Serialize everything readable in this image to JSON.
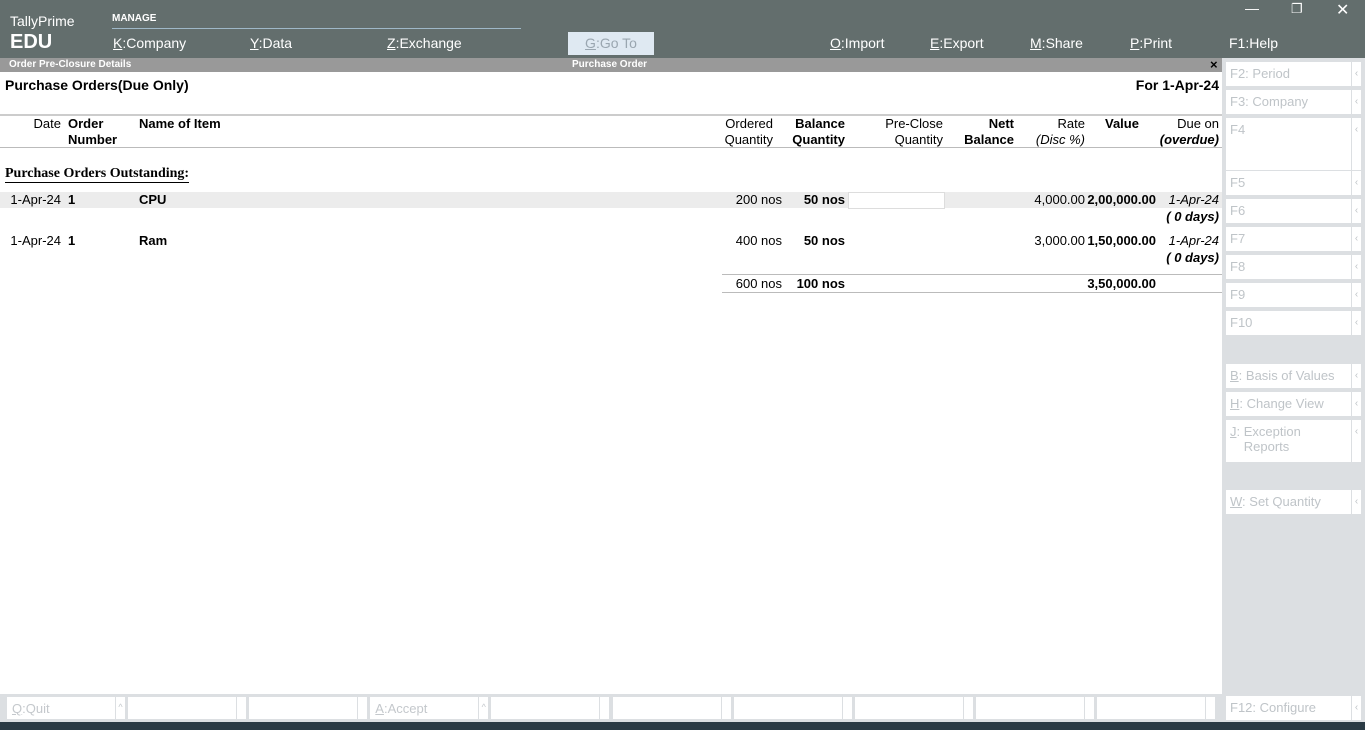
{
  "app": {
    "name": "TallyPrime",
    "edition": "EDU",
    "window_controls": [
      "minimize",
      "restore",
      "close"
    ]
  },
  "topmenu": {
    "section": "MANAGE",
    "items": [
      {
        "key": "K",
        "label": "Company"
      },
      {
        "key": "Y",
        "label": "Data"
      },
      {
        "key": "Z",
        "label": "Exchange"
      }
    ],
    "goto": {
      "key": "G",
      "label": "Go To"
    },
    "right_items": [
      {
        "key": "O",
        "label": "Import"
      },
      {
        "key": "E",
        "label": "Export"
      },
      {
        "key": "M",
        "label": "Share"
      },
      {
        "key": "P",
        "label": "Print"
      },
      {
        "key": "F1",
        "label": "Help"
      }
    ]
  },
  "titlebar": {
    "left": "Order Pre-Closure Details",
    "center": "Purchase Order",
    "close": "×"
  },
  "report": {
    "title": "Purchase Orders(Due Only)",
    "period": "For 1-Apr-24",
    "section": "Purchase Orders Outstanding:"
  },
  "columns": {
    "date": "Date",
    "order1": "Order",
    "order2": "Number",
    "item": "Name of Item",
    "ord1": "Ordered",
    "ord2": "Quantity",
    "bal1": "Balance",
    "bal2": "Quantity",
    "pre1": "Pre-Close",
    "pre2": "Quantity",
    "nett1": "Nett",
    "nett2": "Balance",
    "rate1": "Rate",
    "rate2": "(Disc %)",
    "value": "Value",
    "due1": "Due on",
    "due2": "(overdue)"
  },
  "rows": [
    {
      "date": "1-Apr-24",
      "order": "1",
      "item": "CPU",
      "ordered": "200 nos",
      "balance": "50 nos",
      "preclose": "",
      "rate": "4,000.00",
      "value": "2,00,000.00",
      "due": "1-Apr-24",
      "overdue": "( 0 days)"
    },
    {
      "date": "1-Apr-24",
      "order": "1",
      "item": "Ram",
      "ordered": "400 nos",
      "balance": "50 nos",
      "preclose": "",
      "rate": "3,000.00",
      "value": "1,50,000.00",
      "due": "1-Apr-24",
      "overdue": "( 0 days)"
    }
  ],
  "totals": {
    "ordered": "600 nos",
    "balance": "100 nos",
    "value": "3,50,000.00"
  },
  "side": [
    {
      "key": "F2",
      "label": "Period"
    },
    {
      "key": "F3",
      "label": "Company"
    },
    {
      "key": "F4",
      "label": ""
    },
    {
      "key": "F5",
      "label": ""
    },
    {
      "key": "F6",
      "label": ""
    },
    {
      "key": "F7",
      "label": ""
    },
    {
      "key": "F8",
      "label": ""
    },
    {
      "key": "F9",
      "label": ""
    },
    {
      "key": "F10",
      "label": ""
    },
    {
      "key": "B",
      "label": "Basis of Values"
    },
    {
      "key": "H",
      "label": "Change View"
    },
    {
      "key": "J",
      "label": "Exception Reports"
    },
    {
      "key": "W",
      "label": "Set Quantity"
    }
  ],
  "footer": {
    "quit": {
      "key": "Q",
      "label": "Quit"
    },
    "accept": {
      "key": "A",
      "label": "Accept"
    },
    "configure": {
      "key": "F12",
      "label": "Configure"
    }
  }
}
